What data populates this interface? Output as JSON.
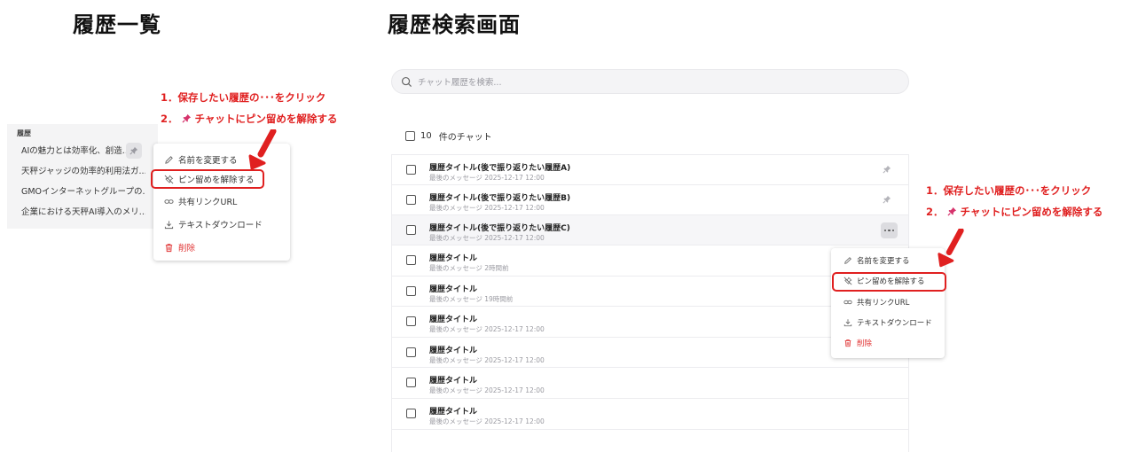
{
  "headings": {
    "left": "履歴一覧",
    "right": "履歴検索画面"
  },
  "instructions": {
    "step1": "1．保存したい履歴の･･･をクリック",
    "step2_prefix": "2．",
    "step2_text": "チャットにピン留めを解除する"
  },
  "sidebar": {
    "label": "履歴",
    "items": [
      "AIの魅力とは効率化、創造...",
      "天秤ジャッジの効率的利用法ガ...",
      "GMOインターネットグループの...",
      "企業における天秤AI導入のメリ..."
    ]
  },
  "menu": {
    "rename": "名前を変更する",
    "unpin": "ピン留めを解除する",
    "share": "共有リンクURL",
    "download": "テキストダウンロード",
    "delete": "削除"
  },
  "search": {
    "placeholder": "チャット履歴を検索..."
  },
  "chat_count": {
    "number": "10",
    "label": "件のチャット"
  },
  "rows": [
    {
      "title": "履歴タイトル(後で振り返りたい履歴A)",
      "sub": "最後のメッセージ 2025-12-17 12:00"
    },
    {
      "title": "履歴タイトル(後で振り返りたい履歴B)",
      "sub": "最後のメッセージ 2025-12-17 12:00"
    },
    {
      "title": "履歴タイトル(後で振り返りたい履歴C)",
      "sub": "最後のメッセージ 2025-12-17 12:00"
    },
    {
      "title": "履歴タイトル",
      "sub": "最後のメッセージ 2時間前"
    },
    {
      "title": "履歴タイトル",
      "sub": "最後のメッセージ 19時間前"
    },
    {
      "title": "履歴タイトル",
      "sub": "最後のメッセージ 2025-12-17 12:00"
    },
    {
      "title": "履歴タイトル",
      "sub": "最後のメッセージ 2025-12-17 12:00"
    },
    {
      "title": "履歴タイトル",
      "sub": "最後のメッセージ 2025-12-17 12:00"
    },
    {
      "title": "履歴タイトル",
      "sub": "最後のメッセージ 2025-12-17 12:00"
    }
  ],
  "colors": {
    "accent_red": "#e02020",
    "danger": "#e03131"
  }
}
